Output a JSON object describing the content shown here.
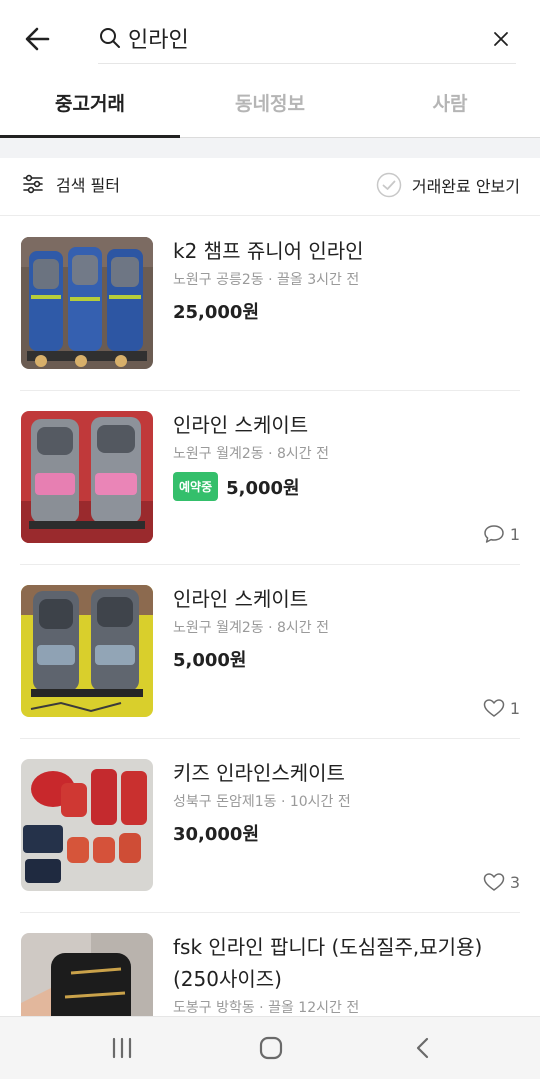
{
  "search": {
    "query": "인라인"
  },
  "tabs": [
    {
      "label": "중고거래",
      "active": true
    },
    {
      "label": "동네정보",
      "active": false
    },
    {
      "label": "사람",
      "active": false
    }
  ],
  "filter": {
    "search_filter_label": "검색 필터",
    "hide_completed_label": "거래완료 안보기"
  },
  "items": [
    {
      "title": "k2 챔프 쥬니어 인라인",
      "meta": "노원구 공릉2동 · 끌올 3시간 전",
      "price": "25,000원",
      "badge": "",
      "count": "",
      "count_type": ""
    },
    {
      "title": "인라인 스케이트",
      "meta": "노원구 월계2동 · 8시간 전",
      "price": "5,000원",
      "badge": "예약중",
      "count": "1",
      "count_type": "chat"
    },
    {
      "title": "인라인 스케이트",
      "meta": "노원구 월계2동 · 8시간 전",
      "price": "5,000원",
      "badge": "",
      "count": "1",
      "count_type": "heart"
    },
    {
      "title": "키즈 인라인스케이트",
      "meta": "성북구 돈암제1동 · 10시간 전",
      "price": "30,000원",
      "badge": "",
      "count": "3",
      "count_type": "heart"
    },
    {
      "title": "fsk 인라인 팝니다 (도심질주,묘기용)(250사이즈)",
      "meta": "도봉구 방학동 · 끌올 12시간 전",
      "price": "",
      "badge": "",
      "count": "",
      "count_type": ""
    }
  ],
  "colors": {
    "badge_green": "#34bf6b",
    "text": "#212121",
    "muted": "#9a9a9a"
  }
}
